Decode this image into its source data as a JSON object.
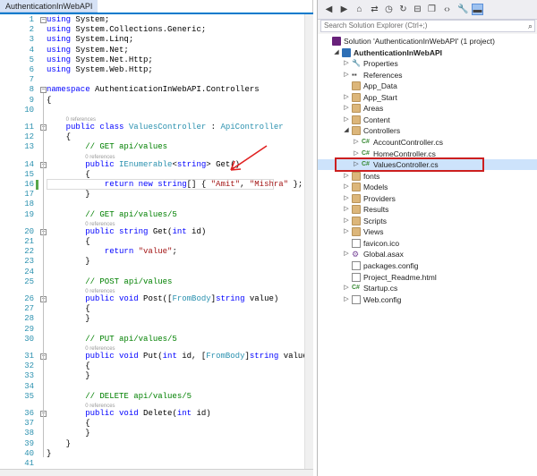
{
  "editor": {
    "tab_title": "AuthenticationInWebAPI",
    "refs_label": "0 references",
    "lines": [
      {
        "n": "1",
        "segs": [
          {
            "t": "using",
            "c": "kw"
          },
          {
            "t": " System;",
            "c": ""
          }
        ]
      },
      {
        "n": "2",
        "segs": [
          {
            "t": "using",
            "c": "kw"
          },
          {
            "t": " System.Collections.Generic;",
            "c": ""
          }
        ]
      },
      {
        "n": "3",
        "segs": [
          {
            "t": "using",
            "c": "kw"
          },
          {
            "t": " System.Linq;",
            "c": ""
          }
        ]
      },
      {
        "n": "4",
        "segs": [
          {
            "t": "using",
            "c": "kw"
          },
          {
            "t": " System.Net;",
            "c": ""
          }
        ]
      },
      {
        "n": "5",
        "segs": [
          {
            "t": "using",
            "c": "kw"
          },
          {
            "t": " System.Net.Http;",
            "c": ""
          }
        ]
      },
      {
        "n": "6",
        "segs": [
          {
            "t": "using",
            "c": "kw"
          },
          {
            "t": " System.Web.Http;",
            "c": ""
          }
        ]
      },
      {
        "n": "7",
        "segs": []
      },
      {
        "n": "8",
        "segs": [
          {
            "t": "namespace",
            "c": "kw"
          },
          {
            "t": " AuthenticationInWebAPI.Controllers",
            "c": ""
          }
        ]
      },
      {
        "n": "9",
        "segs": [
          {
            "t": "{",
            "c": ""
          }
        ]
      },
      {
        "n": "10",
        "segs": []
      },
      {
        "n": "11",
        "segs": [
          {
            "t": "    public",
            "c": "kw"
          },
          {
            "t": " ",
            "c": ""
          },
          {
            "t": "class",
            "c": "kw"
          },
          {
            "t": " ",
            "c": ""
          },
          {
            "t": "ValuesController",
            "c": "ty"
          },
          {
            "t": " : ",
            "c": ""
          },
          {
            "t": "ApiController",
            "c": "ty"
          }
        ]
      },
      {
        "n": "12",
        "segs": [
          {
            "t": "    {",
            "c": ""
          }
        ]
      },
      {
        "n": "13",
        "segs": [
          {
            "t": "        // GET api/values",
            "c": "cm"
          }
        ]
      },
      {
        "n": "14",
        "segs": [
          {
            "t": "        public",
            "c": "kw"
          },
          {
            "t": " ",
            "c": ""
          },
          {
            "t": "IEnumerable",
            "c": "ty"
          },
          {
            "t": "<",
            "c": ""
          },
          {
            "t": "string",
            "c": "kw"
          },
          {
            "t": "> Get()",
            "c": ""
          }
        ]
      },
      {
        "n": "15",
        "segs": [
          {
            "t": "        {",
            "c": ""
          }
        ]
      },
      {
        "n": "16",
        "segs": [
          {
            "t": "            return",
            "c": "kw"
          },
          {
            "t": " ",
            "c": ""
          },
          {
            "t": "new",
            "c": "kw"
          },
          {
            "t": " ",
            "c": ""
          },
          {
            "t": "string",
            "c": "kw"
          },
          {
            "t": "[] { ",
            "c": ""
          },
          {
            "t": "\"Amit\"",
            "c": "st"
          },
          {
            "t": ", ",
            "c": ""
          },
          {
            "t": "\"Mishra\"",
            "c": "st"
          },
          {
            "t": " };",
            "c": ""
          }
        ]
      },
      {
        "n": "17",
        "segs": [
          {
            "t": "        }",
            "c": ""
          }
        ]
      },
      {
        "n": "18",
        "segs": []
      },
      {
        "n": "19",
        "segs": [
          {
            "t": "        // GET api/values/5",
            "c": "cm"
          }
        ]
      },
      {
        "n": "20",
        "segs": [
          {
            "t": "        public",
            "c": "kw"
          },
          {
            "t": " ",
            "c": ""
          },
          {
            "t": "string",
            "c": "kw"
          },
          {
            "t": " Get(",
            "c": ""
          },
          {
            "t": "int",
            "c": "kw"
          },
          {
            "t": " id)",
            "c": ""
          }
        ]
      },
      {
        "n": "21",
        "segs": [
          {
            "t": "        {",
            "c": ""
          }
        ]
      },
      {
        "n": "22",
        "segs": [
          {
            "t": "            return",
            "c": "kw"
          },
          {
            "t": " ",
            "c": ""
          },
          {
            "t": "\"value\"",
            "c": "st"
          },
          {
            "t": ";",
            "c": ""
          }
        ]
      },
      {
        "n": "23",
        "segs": [
          {
            "t": "        }",
            "c": ""
          }
        ]
      },
      {
        "n": "24",
        "segs": []
      },
      {
        "n": "25",
        "segs": [
          {
            "t": "        // POST api/values",
            "c": "cm"
          }
        ]
      },
      {
        "n": "26",
        "segs": [
          {
            "t": "        public",
            "c": "kw"
          },
          {
            "t": " ",
            "c": ""
          },
          {
            "t": "void",
            "c": "kw"
          },
          {
            "t": " Post([",
            "c": ""
          },
          {
            "t": "FromBody",
            "c": "ty"
          },
          {
            "t": "]",
            "c": ""
          },
          {
            "t": "string",
            "c": "kw"
          },
          {
            "t": " value)",
            "c": ""
          }
        ]
      },
      {
        "n": "27",
        "segs": [
          {
            "t": "        {",
            "c": ""
          }
        ]
      },
      {
        "n": "28",
        "segs": [
          {
            "t": "        }",
            "c": ""
          }
        ]
      },
      {
        "n": "29",
        "segs": []
      },
      {
        "n": "30",
        "segs": [
          {
            "t": "        // PUT api/values/5",
            "c": "cm"
          }
        ]
      },
      {
        "n": "31",
        "segs": [
          {
            "t": "        public",
            "c": "kw"
          },
          {
            "t": " ",
            "c": ""
          },
          {
            "t": "void",
            "c": "kw"
          },
          {
            "t": " Put(",
            "c": ""
          },
          {
            "t": "int",
            "c": "kw"
          },
          {
            "t": " id, [",
            "c": ""
          },
          {
            "t": "FromBody",
            "c": "ty"
          },
          {
            "t": "]",
            "c": ""
          },
          {
            "t": "string",
            "c": "kw"
          },
          {
            "t": " value)",
            "c": ""
          }
        ]
      },
      {
        "n": "32",
        "segs": [
          {
            "t": "        {",
            "c": ""
          }
        ]
      },
      {
        "n": "33",
        "segs": [
          {
            "t": "        }",
            "c": ""
          }
        ]
      },
      {
        "n": "34",
        "segs": []
      },
      {
        "n": "35",
        "segs": [
          {
            "t": "        // DELETE api/values/5",
            "c": "cm"
          }
        ]
      },
      {
        "n": "36",
        "segs": [
          {
            "t": "        public",
            "c": "kw"
          },
          {
            "t": " ",
            "c": ""
          },
          {
            "t": "void",
            "c": "kw"
          },
          {
            "t": " Delete(",
            "c": ""
          },
          {
            "t": "int",
            "c": "kw"
          },
          {
            "t": " id)",
            "c": ""
          }
        ]
      },
      {
        "n": "37",
        "segs": [
          {
            "t": "        {",
            "c": ""
          }
        ]
      },
      {
        "n": "38",
        "segs": [
          {
            "t": "        }",
            "c": ""
          }
        ]
      },
      {
        "n": "39",
        "segs": [
          {
            "t": "    }",
            "c": ""
          }
        ]
      },
      {
        "n": "40",
        "segs": [
          {
            "t": "}",
            "c": ""
          }
        ]
      },
      {
        "n": "41",
        "segs": []
      }
    ]
  },
  "solution_explorer": {
    "search_placeholder": "Search Solution Explorer (Ctrl+;)",
    "toolbar_icons": [
      "back-icon",
      "forward-icon",
      "home-icon",
      "sync-icon",
      "history-icon",
      "refresh-icon",
      "collapse-icon",
      "copy-icon",
      "code-icon",
      "properties-icon",
      "pin-icon"
    ],
    "tree": [
      {
        "label": "Solution 'AuthenticationInWebAPI' (1 project)",
        "icon": "solution-icon",
        "exp": "",
        "bold": false
      },
      {
        "label": "AuthenticationInWebAPI",
        "icon": "project-icon",
        "exp": "expanded",
        "bold": true
      },
      {
        "label": "Properties",
        "icon": "wrench-icon",
        "exp": "collapsed",
        "bold": false
      },
      {
        "label": "References",
        "icon": "references-icon",
        "exp": "collapsed",
        "bold": false
      },
      {
        "label": "App_Data",
        "icon": "folder-icon",
        "exp": "",
        "bold": false
      },
      {
        "label": "App_Start",
        "icon": "folder-icon",
        "exp": "collapsed",
        "bold": false
      },
      {
        "label": "Areas",
        "icon": "folder-icon",
        "exp": "collapsed",
        "bold": false
      },
      {
        "label": "Content",
        "icon": "folder-icon",
        "exp": "collapsed",
        "bold": false
      },
      {
        "label": "Controllers",
        "icon": "folder-icon",
        "exp": "expanded",
        "bold": false
      },
      {
        "label": "AccountController.cs",
        "icon": "csharp-file-icon",
        "exp": "collapsed",
        "bold": false
      },
      {
        "label": "HomeController.cs",
        "icon": "csharp-file-icon",
        "exp": "collapsed",
        "bold": false
      },
      {
        "label": "ValuesController.cs",
        "icon": "csharp-file-icon",
        "exp": "collapsed",
        "bold": false,
        "selected": true
      },
      {
        "label": "fonts",
        "icon": "folder-icon",
        "exp": "collapsed",
        "bold": false
      },
      {
        "label": "Models",
        "icon": "folder-icon",
        "exp": "collapsed",
        "bold": false
      },
      {
        "label": "Providers",
        "icon": "folder-icon",
        "exp": "collapsed",
        "bold": false
      },
      {
        "label": "Results",
        "icon": "folder-icon",
        "exp": "collapsed",
        "bold": false
      },
      {
        "label": "Scripts",
        "icon": "folder-icon",
        "exp": "collapsed",
        "bold": false
      },
      {
        "label": "Views",
        "icon": "folder-icon",
        "exp": "collapsed",
        "bold": false
      },
      {
        "label": "favicon.ico",
        "icon": "favicon-icon",
        "exp": "",
        "bold": false
      },
      {
        "label": "Global.asax",
        "icon": "global-asax-icon",
        "exp": "collapsed",
        "bold": false
      },
      {
        "label": "packages.config",
        "icon": "config-file-icon",
        "exp": "",
        "bold": false
      },
      {
        "label": "Project_Readme.html",
        "icon": "html-file-icon",
        "exp": "",
        "bold": false
      },
      {
        "label": "Startup.cs",
        "icon": "csharp-file-icon",
        "exp": "collapsed",
        "bold": false
      },
      {
        "label": "Web.config",
        "icon": "config-file-icon",
        "exp": "collapsed",
        "bold": false
      }
    ]
  },
  "colors": {
    "keyword": "#0000ff",
    "type": "#2b91af",
    "comment": "#008000",
    "string": "#a31515",
    "selection_highlight": "#cc1f1f",
    "annotation_arrow": "#e02020"
  }
}
